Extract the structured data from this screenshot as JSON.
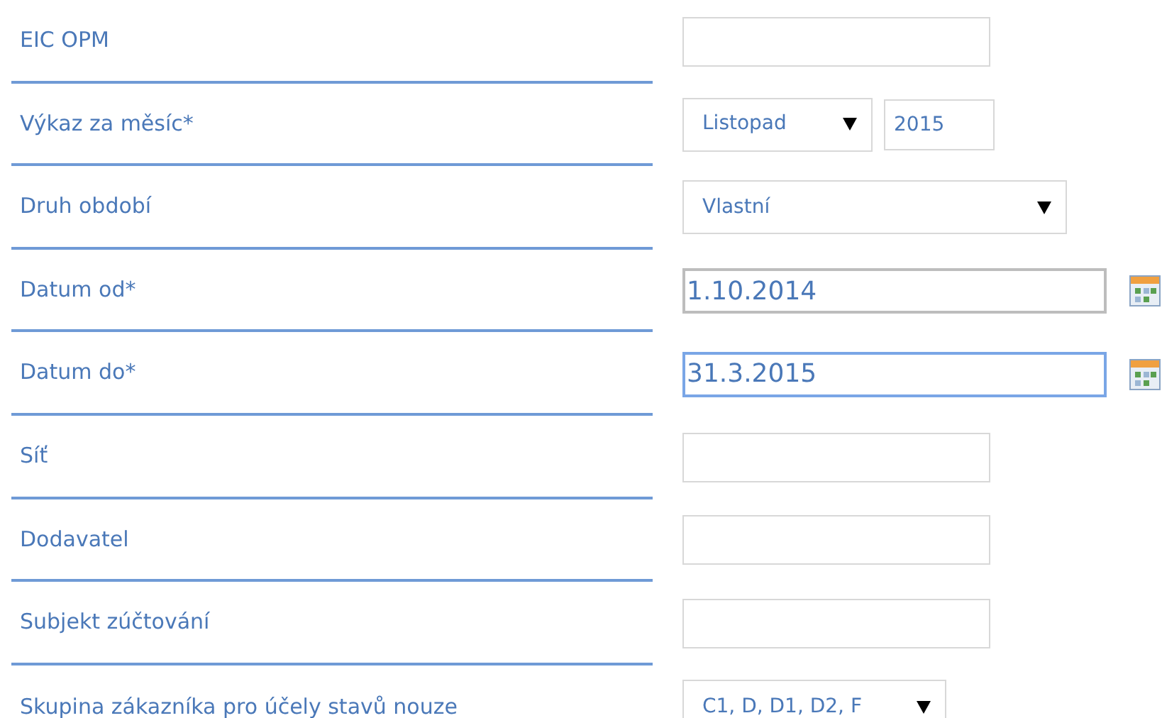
{
  "rows": [
    {
      "label": "EIC OPM",
      "kind": "text",
      "value": ""
    },
    {
      "label": "Výkaz za měsíc*",
      "kind": "month",
      "month": "Listopad",
      "year": "2015"
    },
    {
      "label": "Druh období",
      "kind": "select",
      "value": "Vlastní"
    },
    {
      "label": "Datum od*",
      "kind": "date",
      "value": "1.10.2014",
      "focused": false
    },
    {
      "label": "Datum do*",
      "kind": "date",
      "value": "31.3.2015",
      "focused": true
    },
    {
      "label": "Síť",
      "kind": "text",
      "value": ""
    },
    {
      "label": "Dodavatel",
      "kind": "text",
      "value": ""
    },
    {
      "label": "Subjekt zúčtování",
      "kind": "text",
      "value": ""
    },
    {
      "label": "Skupina zákazníka pro účely stavů nouze",
      "kind": "select-short",
      "value": "C1, D, D1, D2, F"
    }
  ]
}
